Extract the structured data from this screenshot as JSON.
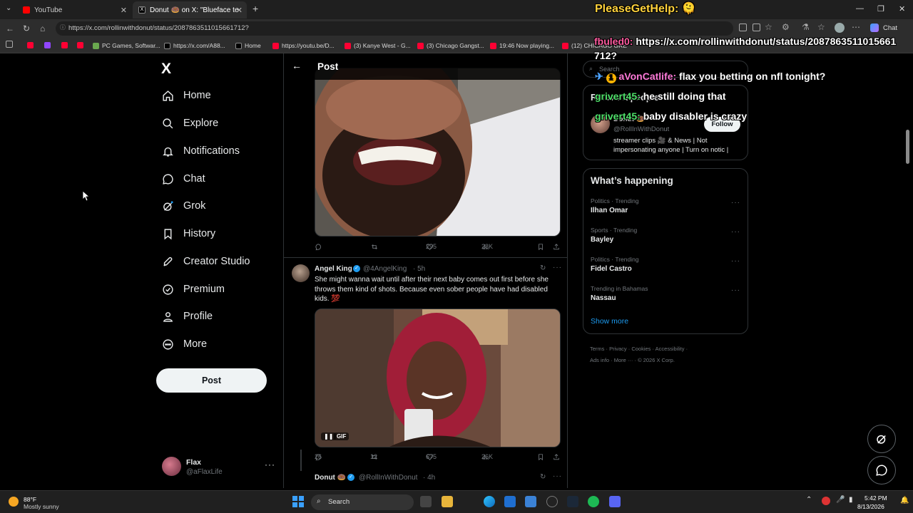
{
  "browser": {
    "tabs": [
      {
        "label": "YouTube",
        "active": false
      },
      {
        "label": "Donut 🍩 on X: \"Blueface tells Ne",
        "active": true
      }
    ],
    "new_tab": "+",
    "url": "https://x.com/rollinwithdonut/status/2087863511015661712?",
    "chat_label": "Chat",
    "bookmarks": [
      "PC Games, Softwar...",
      "https://x.com/A88...",
      "Home",
      "https://youtu.be/D...",
      "(3) Kanye West - G...",
      "(3) Chicago Gangst...",
      "19:46 Now playing...",
      "(12) CHICAGO GRE"
    ]
  },
  "x": {
    "logo": "X",
    "nav": [
      {
        "label": "Home",
        "icon": "home-icon"
      },
      {
        "label": "Explore",
        "icon": "search-icon"
      },
      {
        "label": "Notifications",
        "icon": "bell-icon"
      },
      {
        "label": "Chat",
        "icon": "chat-icon"
      },
      {
        "label": "Grok",
        "icon": "grok-icon"
      },
      {
        "label": "History",
        "icon": "bookmark-icon"
      },
      {
        "label": "Creator Studio",
        "icon": "rocket-icon"
      },
      {
        "label": "Premium",
        "icon": "verified-icon"
      },
      {
        "label": "Profile",
        "icon": "person-icon"
      },
      {
        "label": "More",
        "icon": "more-circle-icon"
      }
    ],
    "post_button": "Post",
    "account": {
      "name": "Flax",
      "handle": "@aFlaxLife",
      "menu": "···"
    },
    "header_title": "Post",
    "tweet1_stats": {
      "replies": "",
      "reposts": "",
      "likes": "295",
      "views": "28K"
    },
    "reply": {
      "name": "Angel King",
      "handle": "@4AngelKing",
      "time": "· 5h",
      "text": "She might wanna wait until after their next baby comes out first before she throws them kind of shots. Because even sober people have had disabled kids. 💯",
      "gif_badge": "GIF",
      "stats": {
        "replies": "26",
        "reposts": "12",
        "likes": "675",
        "views": "26K"
      }
    },
    "next_reply": {
      "name": "Donut 🍩",
      "handle": "@RollInWithDonut",
      "time": "· 4h"
    },
    "search_placeholder": "Search",
    "relevant": {
      "title": "Relevant people",
      "name": "Donut 🍩",
      "handle": "@RollInWithDonut",
      "follow": "Follow",
      "bio": "streamer clips 🎥 & News | Not impersonating anyone | Turn on notic |"
    },
    "happening": {
      "title": "What’s happening",
      "trends": [
        {
          "context": "Politics · Trending",
          "name": "Ilhan Omar"
        },
        {
          "context": "Sports · Trending",
          "name": "Bayley"
        },
        {
          "context": "Politics · Trending",
          "name": "Fidel Castro"
        },
        {
          "context": "Trending in Bahamas",
          "name": "Nassau"
        }
      ],
      "show_more": "Show more"
    },
    "footer": {
      "line1": "Terms · Privacy · Cookies · Accessibility ·",
      "line2": "Ads info · More ··· · © 2026 X Corp."
    }
  },
  "overlay": {
    "donation": "PleaseGetHelp: 🫠",
    "chat": [
      {
        "user": "fbuled0:",
        "msg": "https://x.com/rollinwithdonut/status/2087863511015661",
        "msg2": "712?",
        "color": "#ff5ca0"
      },
      {
        "user": "aVonCatlife:",
        "msg": "flax you betting on nfl tonight?",
        "color": "#ff7ad9"
      },
      {
        "user": "grivert45:",
        "msg": "he still doing that",
        "color": "#4fe06a"
      },
      {
        "user": "grivert45:",
        "msg": "baby disabler is crazy",
        "color": "#4fe06a"
      }
    ]
  },
  "taskbar": {
    "temp": "88°F",
    "weather": "Mostly sunny",
    "search": "Search",
    "time": "5:42 PM",
    "date": "8/13/2026"
  },
  "colors": {
    "accent": "#1d9bf0",
    "background": "#000000",
    "overlay_title": "#ffd23c"
  }
}
